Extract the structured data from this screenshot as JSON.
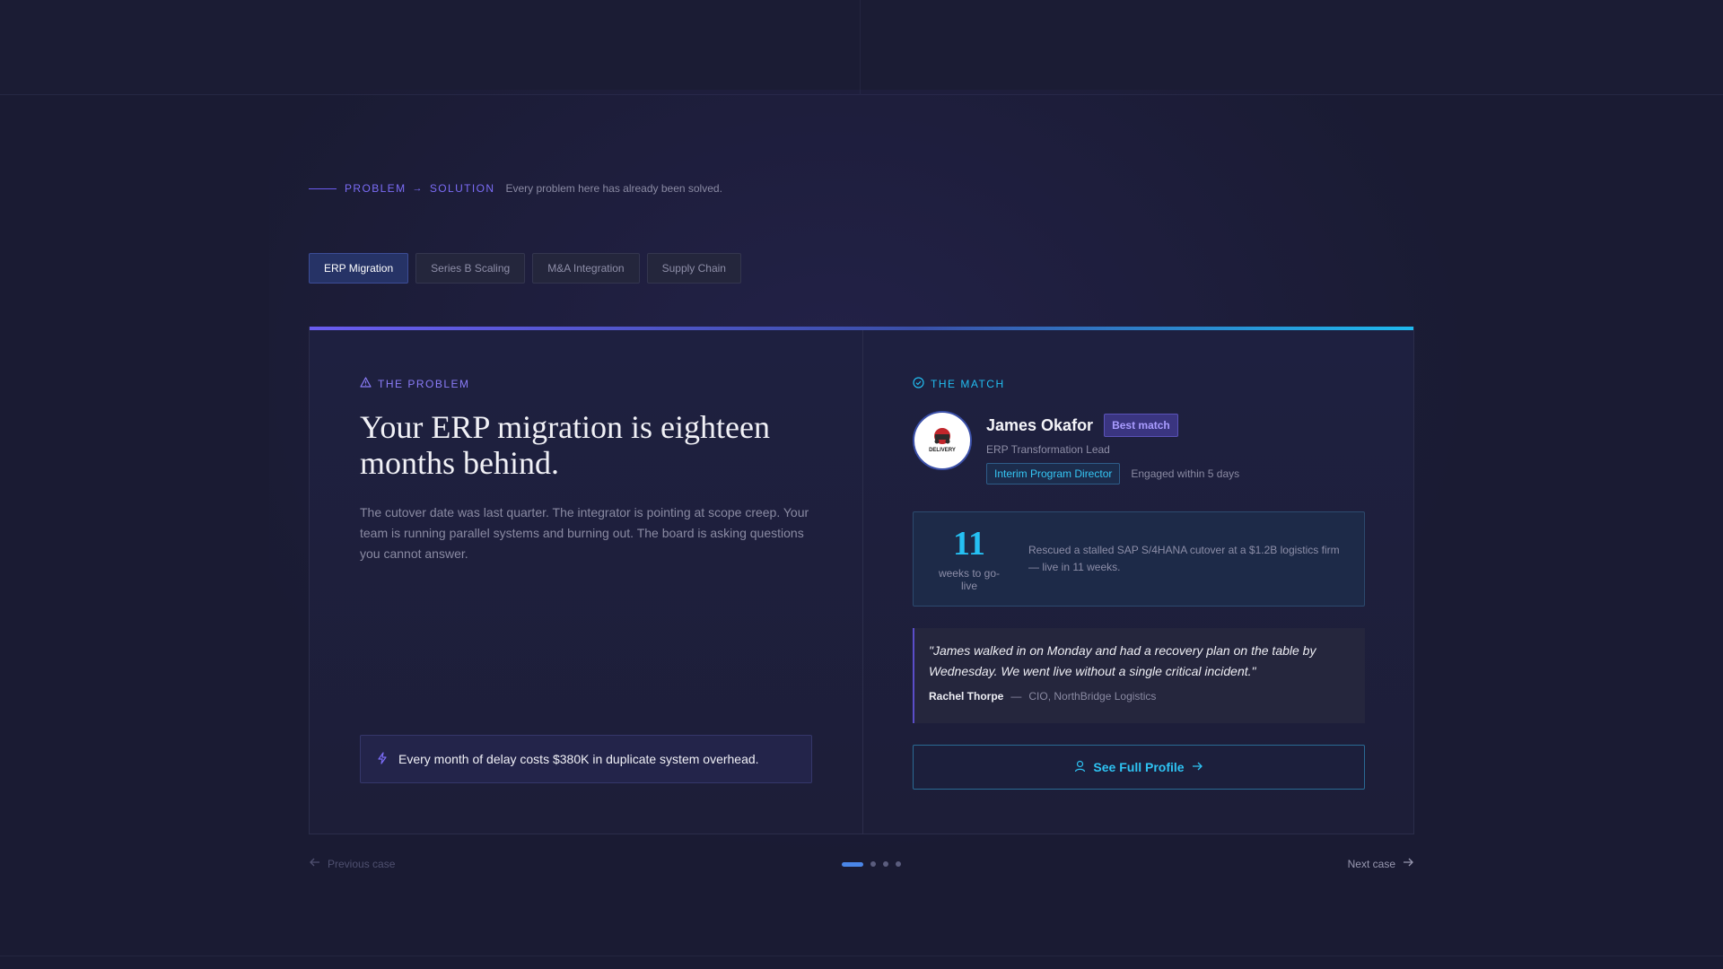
{
  "eyebrow": {
    "problem": "PROBLEM",
    "arrow": "→",
    "solution": "SOLUTION",
    "tagline": "Every problem here has already been solved."
  },
  "tabs": [
    {
      "label": "ERP Migration",
      "active": true
    },
    {
      "label": "Series B Scaling",
      "active": false
    },
    {
      "label": "M&A Integration",
      "active": false
    },
    {
      "label": "Supply Chain",
      "active": false
    }
  ],
  "problem": {
    "section_label": "THE PROBLEM",
    "headline": "Your ERP migration is eighteen months behind.",
    "body": "The cutover date was last quarter. The integrator is pointing at scope creep. Your team is running parallel systems and burning out. The board is asking questions you cannot answer.",
    "cost": "Every month of delay costs $380K in duplicate system overhead."
  },
  "match": {
    "section_label": "THE MATCH",
    "name": "James Okafor",
    "badge": "Best match",
    "title": "ERP Transformation Lead",
    "role": "Interim Program Director",
    "engaged": "Engaged within 5 days",
    "avatar_text": "DELIVERY",
    "stat_number": "11",
    "stat_unit": "weeks to go-live",
    "stat_desc": "Rescued a stalled SAP S/4HANA cutover at a $1.2B logistics firm — live in 11 weeks.",
    "quote": "\"James walked in on Monday and had a recovery plan on the table by Wednesday. We went live without a single critical incident.\"",
    "quote_author": "Rachel Thorpe",
    "quote_dash": "—",
    "quote_role": "CIO, NorthBridge Logistics",
    "cta": "See Full Profile"
  },
  "pager": {
    "prev": "Previous case",
    "next": "Next case",
    "current": 1,
    "total": 4
  },
  "colors": {
    "accent_purple": "#6a5cf0",
    "accent_cyan": "#1fb9ee",
    "background": "#1a1b33"
  }
}
